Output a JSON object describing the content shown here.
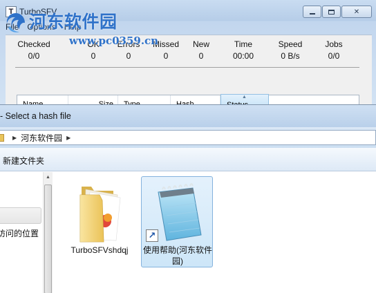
{
  "turbosfv": {
    "icon_glyph": "T",
    "title": "TurboSFV",
    "menu": [
      "File",
      "Options",
      "Help"
    ],
    "stats": [
      {
        "label": "Checked",
        "value": "0/0"
      },
      {
        "label": "OK",
        "value": "0"
      },
      {
        "label": "Errors",
        "value": "0"
      },
      {
        "label": "Missed",
        "value": "0"
      },
      {
        "label": "New",
        "value": "0"
      },
      {
        "label": "Time",
        "value": "00:00"
      },
      {
        "label": "Speed",
        "value": "0  B/s"
      },
      {
        "label": "Jobs",
        "value": "0/0"
      }
    ],
    "columns": [
      "Name",
      "Size",
      "Type",
      "Hash",
      "Status"
    ],
    "sorted_column": "Status"
  },
  "dialog": {
    "title": "- Select a hash file",
    "breadcrumb": [
      "河东软件园"
    ],
    "toolbar": {
      "new_folder_label": "新建文件夹"
    },
    "nav": {
      "location_label": "访问的位置"
    },
    "files": [
      {
        "name": "TurboSFVshdqj",
        "kind": "folder",
        "selected": false
      },
      {
        "name": "使用帮助(河东软件园)",
        "kind": "shortcut",
        "selected": true
      }
    ]
  },
  "watermark": {
    "brand": "河东软件园",
    "url": "www.pc0359.cn"
  },
  "colors": {
    "title_gradient_top": "#c9dcf1",
    "selection_fill": "#cde6f8",
    "selection_border": "#84b2dd",
    "watermark": "#2f72c9",
    "folder_yellow": "#e9c45b"
  }
}
